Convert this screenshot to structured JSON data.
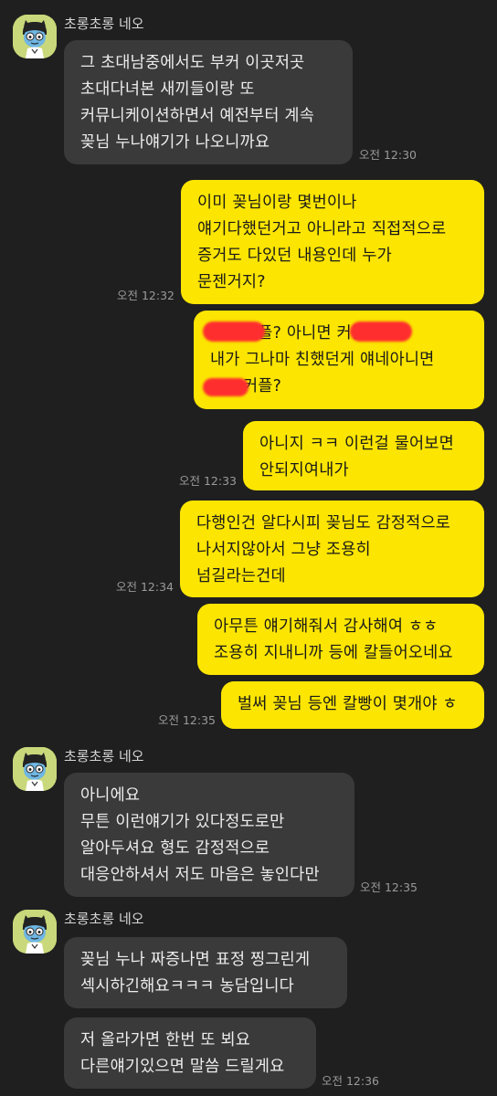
{
  "sender_name": "초롱초롱 네오",
  "messages": [
    {
      "lines": [
        "그 초대남중에서도 부커 이곳저곳",
        "초대다녀본 새끼들이랑 또",
        "커뮤니케이션하면서 예전부터 계속",
        "꽂님 누나얘기가 나오니까요"
      ],
      "time": "오전 12:30"
    },
    {
      "lines": [
        "이미 꽂님이랑 몇번이나",
        "얘기다했던거고 아니라고 직접적으로",
        "증거도 다있던 내용인데 누가",
        "문젠거지?"
      ],
      "time": "오전 12:32"
    },
    {
      "lines": [
        "커플? 아니면 커플인가?",
        "내가 그나마 친했던게 얘네아니면",
        "커플?"
      ]
    },
    {
      "lines": [
        "아니지 ㅋㅋ 이런걸 물어보면",
        "안되지여내가"
      ],
      "time": "오전 12:33"
    },
    {
      "lines": [
        "다행인건 알다시피 꽂님도 감정적으로",
        "나서지않아서 그냥 조용히",
        "넘길라는건데"
      ],
      "time": "오전 12:34"
    },
    {
      "lines": [
        "아무튼 얘기해줘서 감사해여 ㅎㅎ",
        "조용히 지내니까 등에 칼들어오네요"
      ]
    },
    {
      "lines": [
        "벌써 꽂님 등엔 칼빵이 몇개야 ㅎ"
      ],
      "time": "오전 12:35"
    },
    {
      "lines": [
        "아니에요",
        "무튼 이런얘기가 있다정도로만",
        "알아두셔요 형도 감정적으로",
        "대응안하셔서 저도 마음은 놓인다만"
      ],
      "time": "오전 12:35"
    },
    {
      "lines": [
        "꽂님 누나 짜증나면 표정 찡그린게",
        "섹시하긴해요ㅋㅋㅋ 농담입니다"
      ]
    },
    {
      "lines": [
        "저 올라가면 한번 또 뵈요",
        "다른얘기있으면 말씀 드릴게요"
      ],
      "time": "오전 12:36"
    }
  ],
  "icons": {
    "avatar": "neo-character-avatar-icon"
  },
  "colors": {
    "background": "#1f1f1f",
    "incoming": "#3a3a3a",
    "outgoing": "#fce500",
    "redaction": "#ff2e2e"
  }
}
